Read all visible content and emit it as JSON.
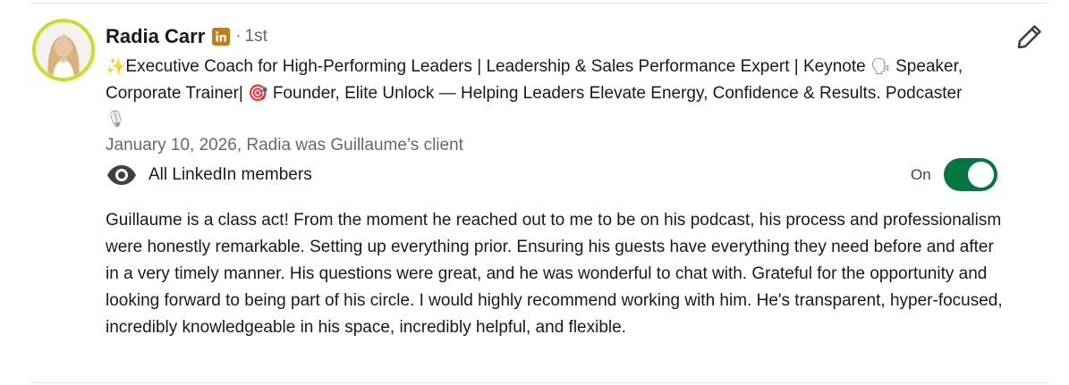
{
  "recommender": {
    "name": "Radia Carr",
    "linkedin_badge": "linkedin-icon",
    "separator": "·",
    "degree": "1st",
    "headline": {
      "sparkle_emoji": "✨",
      "part1": "Executive Coach for High-Performing Leaders | Leadership & Sales Performance Expert | Keynote ",
      "speak_emoji": "🗣",
      "part2": " Speaker, Corporate Trainer| ",
      "target_emoji": "🎯",
      "part3": " Founder, Elite Unlock — Helping Leaders Elevate Energy, Confidence & Results. Podcaster ",
      "mic_emoji": "🎙"
    },
    "meta": "January 10, 2026, Radia was Guillaume’s client",
    "avatar_ring_color": "#c6e02a"
  },
  "visibility": {
    "icon": "eye-icon",
    "label": "All LinkedIn members",
    "toggle_label": "On",
    "toggle_on": true,
    "toggle_color": "#057642"
  },
  "edit_icon": "pencil-icon",
  "recommendation_text": "Guillaume is a class act! From the moment he reached out to me to be on his podcast, his process and professionalism were honestly remarkable. Setting up everything prior. Ensuring his guests have everything they need before and after in a very timely manner. His questions were great, and he was wonderful to chat with. Grateful for the opportunity and looking forward to being part of his circle. I would highly recommend working with him. He's transparent, hyper-focused, incredibly knowledgeable in his space, incredibly helpful, and flexible."
}
